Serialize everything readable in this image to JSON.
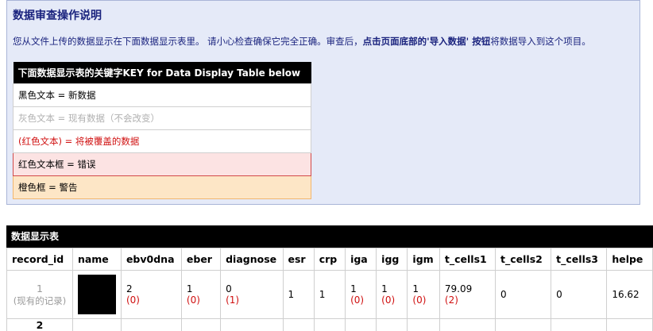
{
  "instructions": {
    "title": "数据审查操作说明",
    "text_plain": "您从文件上传的数据显示在下面数据显示表里。 请小心检查确保它完全正确。审查后，",
    "text_bold": "点击页面底部的'导入数据' 按钮",
    "text_end": "将数据导入到这个项目。"
  },
  "key_table": {
    "header": "下面数据显示表的关键字KEY for Data Display Table below",
    "rows": [
      "黑色文本 = 新数据",
      "灰色文本 = 现有数据（不会改变）",
      "(红色文本) = 将被覆盖的数据",
      "红色文本框 = 错误",
      "橙色框 = 警告"
    ]
  },
  "data_table": {
    "title": "数据显示表",
    "columns": [
      "record_id",
      "name",
      "ebv0dna",
      "eber",
      "diagnose",
      "esr",
      "crp",
      "iga",
      "igg",
      "igm",
      "t_cells1",
      "t_cells2",
      "t_cells3",
      "helpe"
    ],
    "row1": {
      "record_id": "1",
      "record_note": "(现有的记录)",
      "ebv0dna": {
        "new": "2",
        "old": "(0)"
      },
      "eber": {
        "new": "1",
        "old": "(0)"
      },
      "diagnose": {
        "new": "0",
        "old": "(1)"
      },
      "esr": "1",
      "crp": "1",
      "iga": {
        "new": "1",
        "old": "(0)"
      },
      "igg": {
        "new": "1",
        "old": "(0)"
      },
      "igm": {
        "new": "1",
        "old": "(0)"
      },
      "t_cells1": {
        "new": "79.09",
        "old": "(2)"
      },
      "t_cells2": "0",
      "t_cells3": "0",
      "helpe": "16.62"
    },
    "row2": {
      "record_id": "2"
    }
  }
}
